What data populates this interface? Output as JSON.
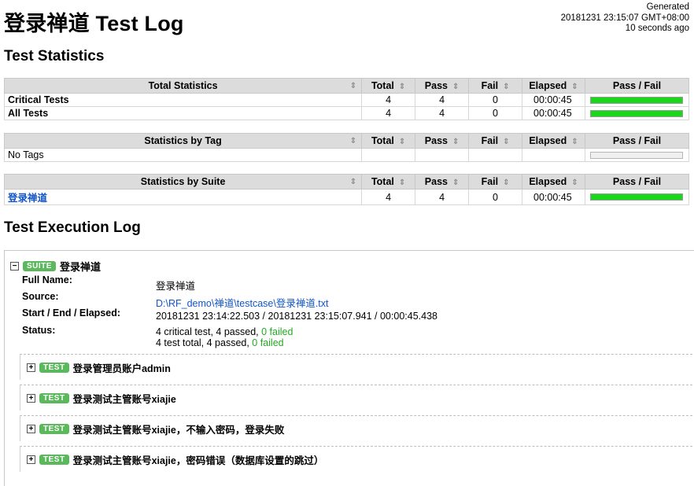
{
  "header": {
    "title": "登录禅道 Test Log",
    "generated_label": "Generated",
    "generated_time": "20181231 23:15:07 GMT+08:00",
    "generated_ago": "10 seconds ago"
  },
  "sections": {
    "stats_title": "Test Statistics",
    "log_title": "Test Execution Log"
  },
  "columns": {
    "total_stats": "Total Statistics",
    "by_tag": "Statistics by Tag",
    "by_suite": "Statistics by Suite",
    "total": "Total",
    "pass": "Pass",
    "fail": "Fail",
    "elapsed": "Elapsed",
    "pass_fail": "Pass / Fail",
    "sort_glyph": "⇕"
  },
  "total_stats": [
    {
      "label": "Critical Tests",
      "total": "4",
      "pass": "4",
      "fail": "0",
      "elapsed": "00:00:45",
      "pass_ratio": 1.0
    },
    {
      "label": "All Tests",
      "total": "4",
      "pass": "4",
      "fail": "0",
      "elapsed": "00:00:45",
      "pass_ratio": 1.0
    }
  ],
  "tag_stats": [
    {
      "label": "No Tags",
      "total": "",
      "pass": "",
      "fail": "",
      "elapsed": "",
      "pass_ratio": 0
    }
  ],
  "suite_stats": [
    {
      "label": "登录禅道",
      "total": "4",
      "pass": "4",
      "fail": "0",
      "elapsed": "00:00:45",
      "pass_ratio": 1.0
    }
  ],
  "suite": {
    "badge": "SUITE",
    "name": "登录禅道",
    "expander": "−",
    "full_name_label": "Full Name:",
    "full_name": "登录禅道",
    "source_label": "Source:",
    "source": "D:\\RF_demo\\禅道\\testcase\\登录禅道.txt",
    "times_label": "Start / End / Elapsed:",
    "times": "20181231 23:14:22.503 / 20181231 23:15:07.941 / 00:00:45.438",
    "status_label": "Status:",
    "status_line1_prefix": "4 critical test, 4 passed, ",
    "status_line1_failed": "0 failed",
    "status_line2_prefix": "4 test total, 4 passed, ",
    "status_line2_failed": "0 failed"
  },
  "tests": [
    {
      "badge": "TEST",
      "expander": "+",
      "name": "登录管理员账户admin"
    },
    {
      "badge": "TEST",
      "expander": "+",
      "name": "登录测试主管账号xiajie"
    },
    {
      "badge": "TEST",
      "expander": "+",
      "name": "登录测试主管账号xiajie，不输入密码，登录失败"
    },
    {
      "badge": "TEST",
      "expander": "+",
      "name": "登录测试主管账号xiajie，密码错误（数据库设置的跳过）"
    }
  ]
}
